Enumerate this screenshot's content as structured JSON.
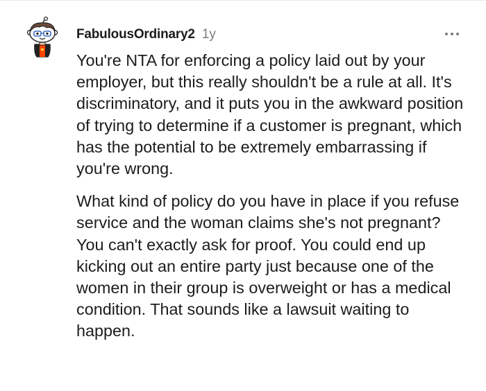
{
  "comment": {
    "username": "FabulousOrdinary2",
    "age": "1y",
    "more_icon": "more-horizontal-icon",
    "paragraphs": [
      "You're NTA for enforcing a policy laid out by your employer, but this really shouldn't be a rule at all. It's discriminatory, and it puts you in the awkward position of trying to determine if a customer is pregnant, which has the potential to be extremely embarrassing if you're wrong.",
      "What kind of policy do you have in place if you refuse service and the woman claims she's not pregnant? You can't exactly ask for proof. You could end up kicking out an entire party just because one of the women in their group is overweight or has a medical condition. That sounds like a lawsuit waiting to happen."
    ]
  },
  "colors": {
    "text": "#1c1c1c",
    "meta": "#7c7c7c",
    "avatar_hair": "#6b4a3a",
    "avatar_shirt": "#ff4500",
    "avatar_jacket": "#222222"
  }
}
